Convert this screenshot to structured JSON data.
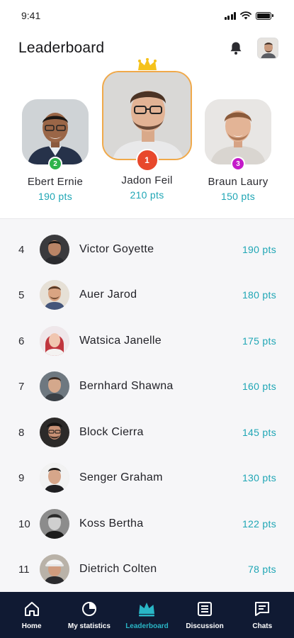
{
  "status_bar": {
    "time": "9:41"
  },
  "header": {
    "title": "Leaderboard"
  },
  "podium": [
    {
      "rank": "2",
      "name": "Ebert Ernie",
      "points": "190 pts",
      "badge_color": "#2db34a"
    },
    {
      "rank": "1",
      "name": "Jadon Feil",
      "points": "210 pts",
      "badge_color": "#e8482c"
    },
    {
      "rank": "3",
      "name": "Braun Laury",
      "points": "150 pts",
      "badge_color": "#c41ac9"
    }
  ],
  "leaderboard": [
    {
      "rank": "4",
      "name": "Victor Goyette",
      "points": "190 pts"
    },
    {
      "rank": "5",
      "name": "Auer Jarod",
      "points": "180 pts"
    },
    {
      "rank": "6",
      "name": "Watsica Janelle",
      "points": "175 pts"
    },
    {
      "rank": "7",
      "name": "Bernhard Shawna",
      "points": "160 pts"
    },
    {
      "rank": "8",
      "name": "Block Cierra",
      "points": "145 pts"
    },
    {
      "rank": "9",
      "name": "Senger Graham",
      "points": "130 pts"
    },
    {
      "rank": "10",
      "name": "Koss Bertha",
      "points": "122 pts"
    },
    {
      "rank": "11",
      "name": "Dietrich Colten",
      "points": "78 pts"
    }
  ],
  "bottom_nav": [
    {
      "label": "Home",
      "icon": "home-icon",
      "active": false
    },
    {
      "label": "My statistics",
      "icon": "pie-chart-icon",
      "active": false
    },
    {
      "label": "Leaderboard",
      "icon": "crown-icon",
      "active": true
    },
    {
      "label": "Discussion",
      "icon": "list-icon",
      "active": false
    },
    {
      "label": "Chats",
      "icon": "chat-icon",
      "active": false
    }
  ],
  "colors": {
    "accent": "#1fa6b5",
    "nav_background": "#101a33",
    "nav_active": "#29b6c6",
    "first_place_border": "#f0a94a",
    "crown": "#f5c21b"
  }
}
